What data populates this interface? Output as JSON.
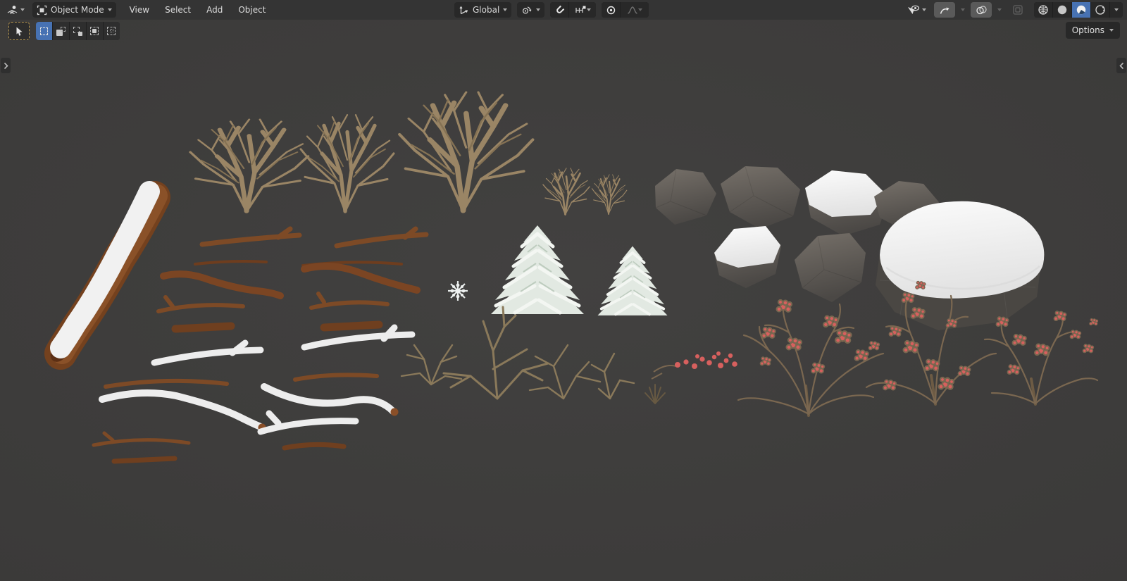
{
  "header": {
    "editor_type_icon": "editor-type-3d-viewport-icon",
    "mode_label": "Object Mode",
    "mode_icon": "object-mode-icon",
    "menus": [
      {
        "label": "View"
      },
      {
        "label": "Select"
      },
      {
        "label": "Add"
      },
      {
        "label": "Object"
      }
    ],
    "orientation_label": "Global",
    "shading_modes": [
      "wireframe",
      "solid",
      "material-preview",
      "rendered"
    ],
    "active_shading_mode": "material-preview"
  },
  "tool": {
    "active_tool": "select-box",
    "select_modes": [
      "set",
      "extend",
      "subtract",
      "invert",
      "intersect"
    ],
    "active_select_mode": "set",
    "options_label": "Options"
  },
  "viewport": {
    "objects": [
      "snow-covered-log",
      "bare-twig-bush-small",
      "bare-twig-bush-medium",
      "bare-twig-bush-large",
      "bare-sapling",
      "branch-sticks-brown",
      "branch-sticks-snowy",
      "snowflake-plant",
      "snowy-pine-tree-large",
      "snowy-pine-tree-small",
      "ground-twigs",
      "rock-gray",
      "rock-snow-capped",
      "boulder-large-snow-capped",
      "red-berry-cluster",
      "red-berry-bush"
    ],
    "colors": {
      "accent_blue": "#4772b3",
      "header_bg": "#343434",
      "viewport_bg": "#3e3d3c",
      "snow": "#f1f1f1",
      "wood_brown": "#7a4622",
      "twig_tan": "#9a8565",
      "rock_gray": "#5b5753",
      "berry_red": "#d7605e",
      "pine_white": "#e9efe9"
    }
  }
}
